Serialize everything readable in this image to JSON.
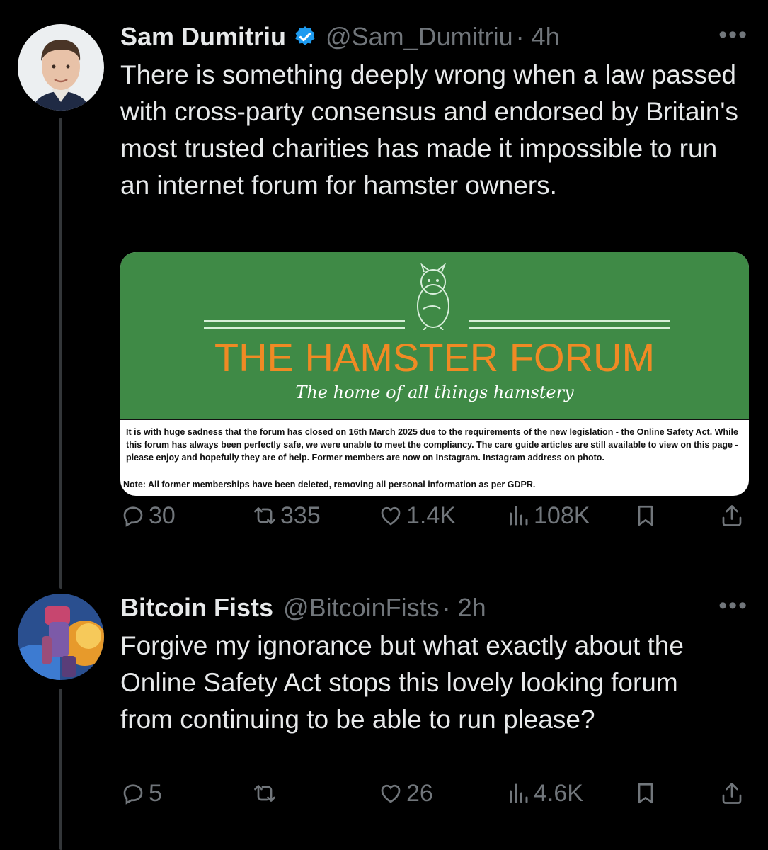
{
  "tweets": [
    {
      "name": "Sam Dumitriu",
      "handle": "@Sam_Dumitriu",
      "time": "· 4h",
      "text": "There is something deeply wrong when a law passed with cross-party consensus and endorsed by Britain's most trusted charities has made it impossible to run an internet forum for hamster owners.",
      "replies": "30",
      "reposts": "335",
      "likes": "1.4K",
      "views": "108K",
      "image": {
        "title": "THE HAMSTER FORUM",
        "tagline": "The home of all things hamstery",
        "notice": "It is with huge sadness that the forum has closed on 16th March 2025 due to the requirements of the new legislation - the Online Safety Act. While this forum has always been perfectly safe, we were unable to meet the compliancy. The care guide articles are still available to view on this page - please enjoy and hopefully they are of help. Former members are now on Instagram. Instagram address on photo.",
        "note": "Note: All former memberships have been deleted, removing all personal information as per GDPR."
      }
    },
    {
      "name": "Bitcoin Fists",
      "handle": "@BitcoinFists",
      "time": "· 2h",
      "text": "Forgive my ignorance but what exactly about the Online Safety Act stops this lovely looking forum from continuing to be able to run please?",
      "replies": "5",
      "reposts": "",
      "likes": "26",
      "views": "4.6K"
    }
  ],
  "more_label": "•••",
  "colors": {
    "background": "#000000",
    "text": "#e7e9ea",
    "muted": "#71767b",
    "verified": "#1d9bf0",
    "card_green": "#3f8a46",
    "card_title": "#f08a24"
  },
  "icons": [
    "reply-icon",
    "repost-icon",
    "like-icon",
    "views-icon",
    "bookmark-icon",
    "share-icon",
    "verified-badge-icon",
    "more-icon"
  ]
}
